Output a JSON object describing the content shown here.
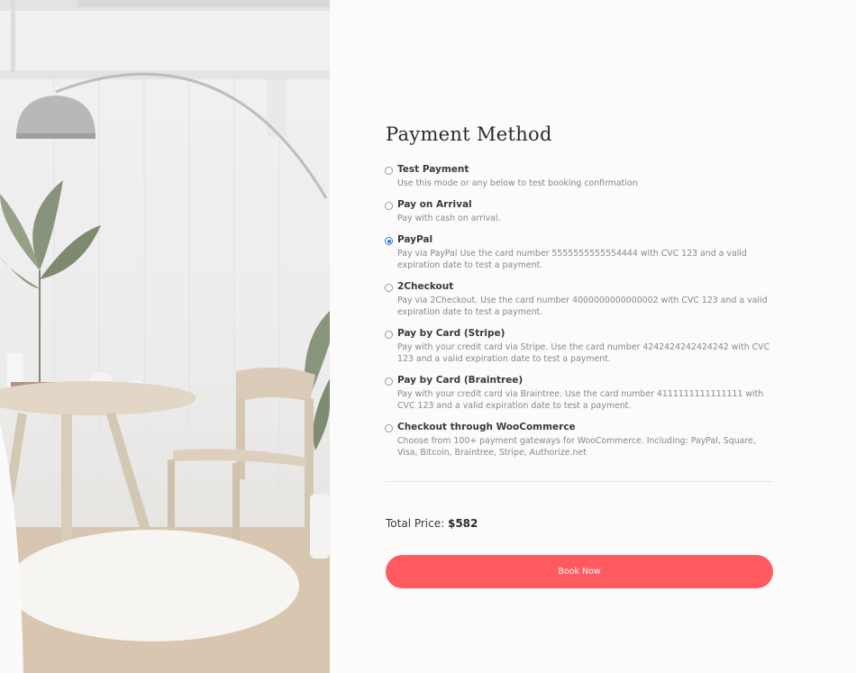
{
  "payment": {
    "title": "Payment Method",
    "methods": [
      {
        "name": "Test Payment",
        "description": "Use this mode or any below to test booking confirmation",
        "selected": false
      },
      {
        "name": "Pay on Arrival",
        "description": "Pay with cash on arrival.",
        "selected": false
      },
      {
        "name": "PayPal",
        "description": "Pay via PayPal Use the card number 5555555555554444 with CVC 123 and a valid expiration date to test a payment.",
        "selected": true
      },
      {
        "name": "2Checkout",
        "description": "Pay via 2Checkout. Use the card number 4000000000000002 with CVC 123 and a valid expiration date to test a payment.",
        "selected": false
      },
      {
        "name": "Pay by Card (Stripe)",
        "description": "Pay with your credit card via Stripe. Use the card number 4242424242424242 with CVC 123 and a valid expiration date to test a payment.",
        "selected": false
      },
      {
        "name": "Pay by Card (Braintree)",
        "description": "Pay with your credit card via Braintree. Use the card number 4111111111111111 with CVC 123 and a valid expiration date to test a payment.",
        "selected": false
      },
      {
        "name": "Checkout through WooCommerce",
        "description": "Choose from 100+ payment gateways for WooCommerce. Including: PayPal, Square, Visa, Bitcoin, Braintree, Stripe, Authorize.net",
        "selected": false
      }
    ]
  },
  "total": {
    "label": "Total Price:",
    "amount": "$582"
  },
  "book_button": {
    "label": "Book Now"
  },
  "colors": {
    "accent": "#ff5a5f",
    "radio_selected": "#2c7bd6",
    "background": "#fcfbfa"
  }
}
